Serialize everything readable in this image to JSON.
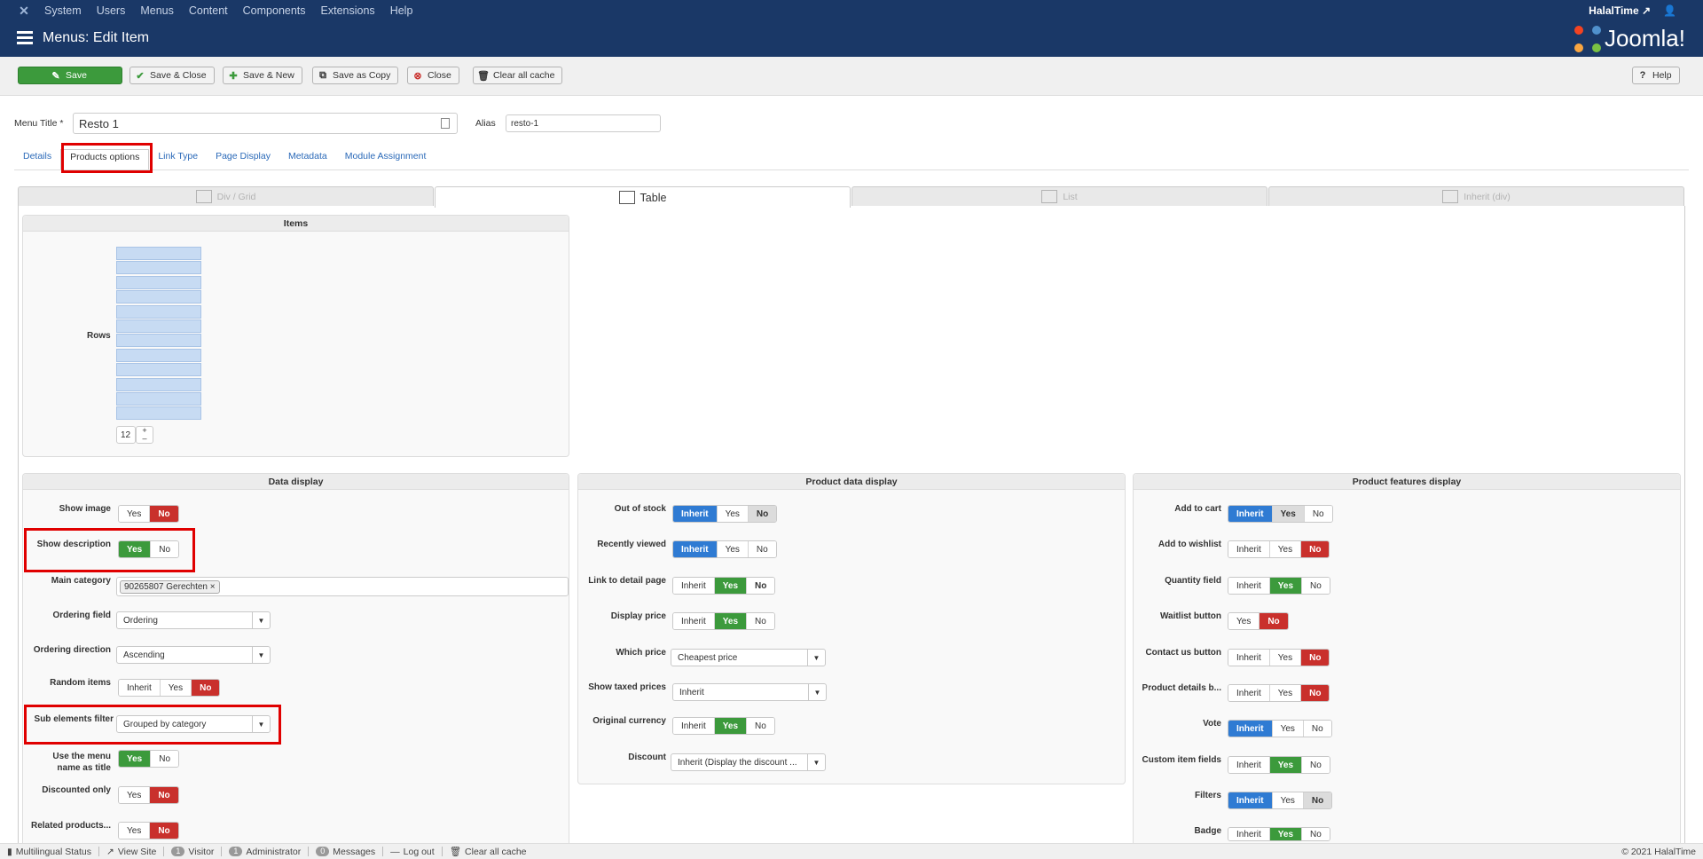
{
  "topbar": {
    "menu": [
      "System",
      "Users",
      "Menus",
      "Content",
      "Components",
      "Extensions",
      "Help"
    ],
    "site_name": "HalalTime"
  },
  "header": {
    "title": "Menus: Edit Item",
    "brand": "Joomla!"
  },
  "toolbar": {
    "save": "Save",
    "save_close": "Save & Close",
    "save_new": "Save & New",
    "save_copy": "Save as Copy",
    "close": "Close",
    "clear_cache": "Clear all cache",
    "help": "Help"
  },
  "form": {
    "menu_title_label": "Menu Title *",
    "menu_title_value": "Resto 1",
    "alias_label": "Alias",
    "alias_value": "resto-1"
  },
  "tabs": [
    "Details",
    "Products options",
    "Link Type",
    "Page Display",
    "Metadata",
    "Module Assignment"
  ],
  "layout_tabs": [
    "Div / Grid",
    "Table",
    "List",
    "Inherit (div)"
  ],
  "items_panel": {
    "title": "Items",
    "rows_label": "Rows",
    "rows_value": "12",
    "plus": "+",
    "minus": "–"
  },
  "data_display": {
    "title": "Data display",
    "show_image": {
      "label": "Show image",
      "options": [
        "Yes",
        "No"
      ]
    },
    "show_description": {
      "label": "Show description",
      "options": [
        "Yes",
        "No"
      ]
    },
    "main_category": {
      "label": "Main category",
      "tag": "90265807 Gerechten",
      "remove": "×"
    },
    "ordering_field": {
      "label": "Ordering field",
      "value": "Ordering"
    },
    "ordering_direction": {
      "label": "Ordering direction",
      "value": "Ascending"
    },
    "random_items": {
      "label": "Random items",
      "options": [
        "Inherit",
        "Yes",
        "No"
      ]
    },
    "sub_elements_filter": {
      "label": "Sub elements filter",
      "value": "Grouped by category"
    },
    "use_menu_name_1": "Use the menu",
    "use_menu_name_2": "name as title",
    "use_menu_name_options": [
      "Yes",
      "No"
    ],
    "discounted_only": {
      "label": "Discounted only",
      "options": [
        "Yes",
        "No"
      ]
    },
    "related_products": {
      "label": "Related products...",
      "options": [
        "Yes",
        "No"
      ]
    }
  },
  "product_data_display": {
    "title": "Product data display",
    "out_of_stock": {
      "label": "Out of stock",
      "options": [
        "Inherit",
        "Yes",
        "No"
      ]
    },
    "recently_viewed": {
      "label": "Recently viewed",
      "options": [
        "Inherit",
        "Yes",
        "No"
      ]
    },
    "link_detail": {
      "label": "Link to detail page",
      "options": [
        "Inherit",
        "Yes",
        "No"
      ]
    },
    "display_price": {
      "label": "Display price",
      "options": [
        "Inherit",
        "Yes",
        "No"
      ]
    },
    "which_price": {
      "label": "Which price",
      "value": "Cheapest price"
    },
    "show_taxed": {
      "label": "Show taxed prices",
      "value": "Inherit"
    },
    "original_currency": {
      "label": "Original currency",
      "options": [
        "Inherit",
        "Yes",
        "No"
      ]
    },
    "discount": {
      "label": "Discount",
      "value": "Inherit (Display the discount ..."
    }
  },
  "product_features_display": {
    "title": "Product features display",
    "add_to_cart": {
      "label": "Add to cart",
      "options": [
        "Inherit",
        "Yes",
        "No"
      ]
    },
    "add_to_wishlist": {
      "label": "Add to wishlist",
      "options": [
        "Inherit",
        "Yes",
        "No"
      ]
    },
    "quantity_field": {
      "label": "Quantity field",
      "options": [
        "Inherit",
        "Yes",
        "No"
      ]
    },
    "waitlist_button": {
      "label": "Waitlist button",
      "options": [
        "Yes",
        "No"
      ]
    },
    "contact_us": {
      "label": "Contact us button",
      "options": [
        "Inherit",
        "Yes",
        "No"
      ]
    },
    "product_details": {
      "label": "Product details b...",
      "options": [
        "Inherit",
        "Yes",
        "No"
      ]
    },
    "vote": {
      "label": "Vote",
      "options": [
        "Inherit",
        "Yes",
        "No"
      ]
    },
    "custom_fields": {
      "label": "Custom item fields",
      "options": [
        "Inherit",
        "Yes",
        "No"
      ]
    },
    "filters": {
      "label": "Filters",
      "options": [
        "Inherit",
        "Yes",
        "No"
      ]
    },
    "badge": {
      "label": "Badge",
      "options": [
        "Inherit",
        "Yes",
        "No"
      ]
    }
  },
  "statusbar": {
    "multilingual": "Multilingual Status",
    "view_site": "View Site",
    "visitors_count": "1",
    "visitor": "Visitor",
    "admin_count": "1",
    "administrator": "Administrator",
    "messages_count": "0",
    "messages": "Messages",
    "logout": "Log out",
    "clear_cache": "Clear all cache",
    "copyright": "© 2021 HalalTime"
  }
}
